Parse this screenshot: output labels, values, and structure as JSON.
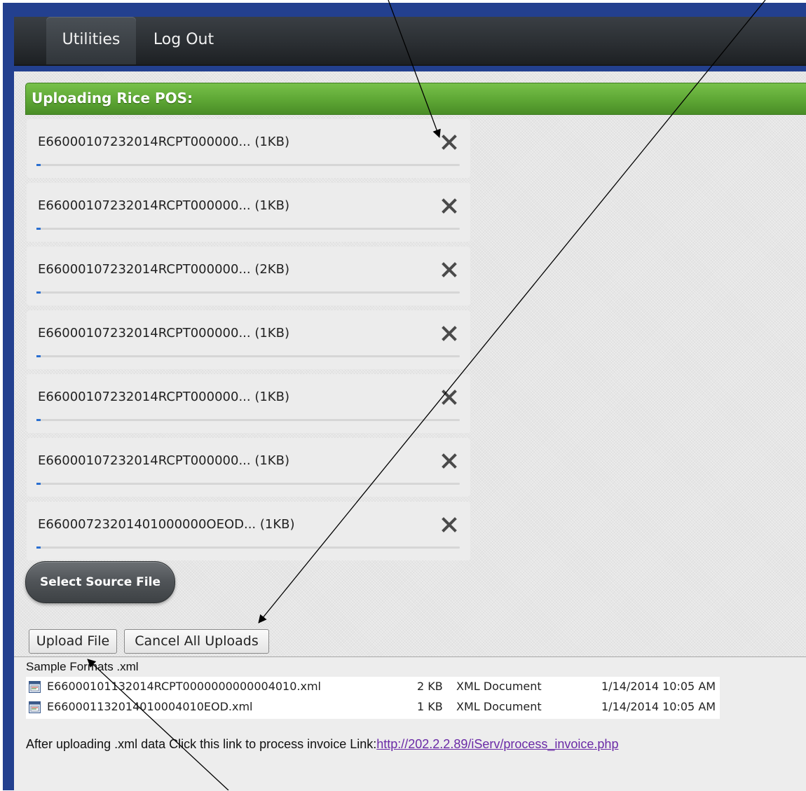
{
  "nav": {
    "items": [
      {
        "label": "Utilities"
      },
      {
        "label": "Log Out"
      }
    ]
  },
  "panel": {
    "title": "Uploading Rice POS:"
  },
  "queue": [
    {
      "label": "E66000107232014RCPT000000... (1KB)",
      "progress": 0.01
    },
    {
      "label": "E66000107232014RCPT000000... (1KB)",
      "progress": 0.01
    },
    {
      "label": "E66000107232014RCPT000000... (2KB)",
      "progress": 0.01
    },
    {
      "label": "E66000107232014RCPT000000... (1KB)",
      "progress": 0.01
    },
    {
      "label": "E66000107232014RCPT000000... (1KB)",
      "progress": 0.01
    },
    {
      "label": "E66000107232014RCPT000000... (1KB)",
      "progress": 0.01
    },
    {
      "label": "E66000723201401000000OEOD... (1KB)",
      "progress": 0.01
    }
  ],
  "select_button": "Select Source File",
  "upload_button": "Upload File",
  "cancel_button": "Cancel All Uploads",
  "samples": {
    "label": "Sample Formats .xml",
    "files": [
      {
        "name": "E66000101132014RCPT0000000000004010.xml",
        "size": "2 KB",
        "type": "XML Document",
        "date": "1/14/2014 10:05 AM"
      },
      {
        "name": "E660001132014010004010EOD.xml",
        "size": "1 KB",
        "type": "XML Document",
        "date": "1/14/2014 10:05 AM"
      }
    ]
  },
  "note": {
    "text": "After uploading .xml data Click this link to process invoice Link:",
    "link": "http://202.2.2.89/iServ/process_invoice.php"
  },
  "colors": {
    "header_green": "#5da634",
    "frame_blue": "#23408f",
    "link_purple": "#6a2aa6"
  }
}
